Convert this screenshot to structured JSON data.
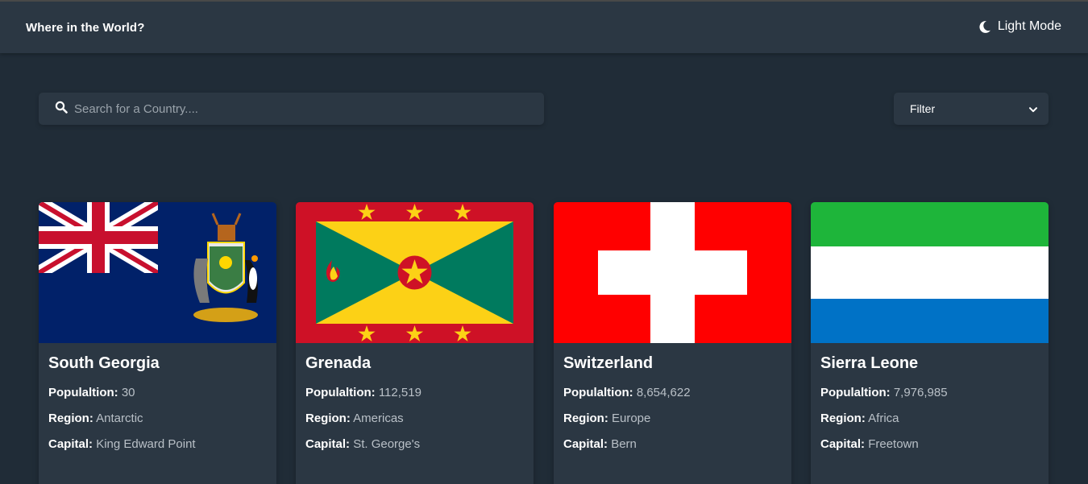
{
  "header": {
    "title": "Where in the World?",
    "mode_label": "Light Mode"
  },
  "search": {
    "placeholder": "Search for a Country...."
  },
  "filter": {
    "label": "Filter"
  },
  "labels": {
    "population": "Populaltion:",
    "region": "Region:",
    "capital": "Capital:"
  },
  "countries": [
    {
      "name": "South Georgia",
      "population": "30",
      "region": "Antarctic",
      "capital": "King Edward Point",
      "flag": "south-georgia"
    },
    {
      "name": "Grenada",
      "population": "112,519",
      "region": "Americas",
      "capital": "St. George's",
      "flag": "grenada"
    },
    {
      "name": "Switzerland",
      "population": "8,654,622",
      "region": "Europe",
      "capital": "Bern",
      "flag": "switzerland"
    },
    {
      "name": "Sierra Leone",
      "population": "7,976,985",
      "region": "Africa",
      "capital": "Freetown",
      "flag": "sierra-leone"
    }
  ],
  "colors": {
    "background": "#202c37",
    "element": "#2b3743",
    "text": "#ffffff",
    "muted": "#b9c0c7"
  }
}
